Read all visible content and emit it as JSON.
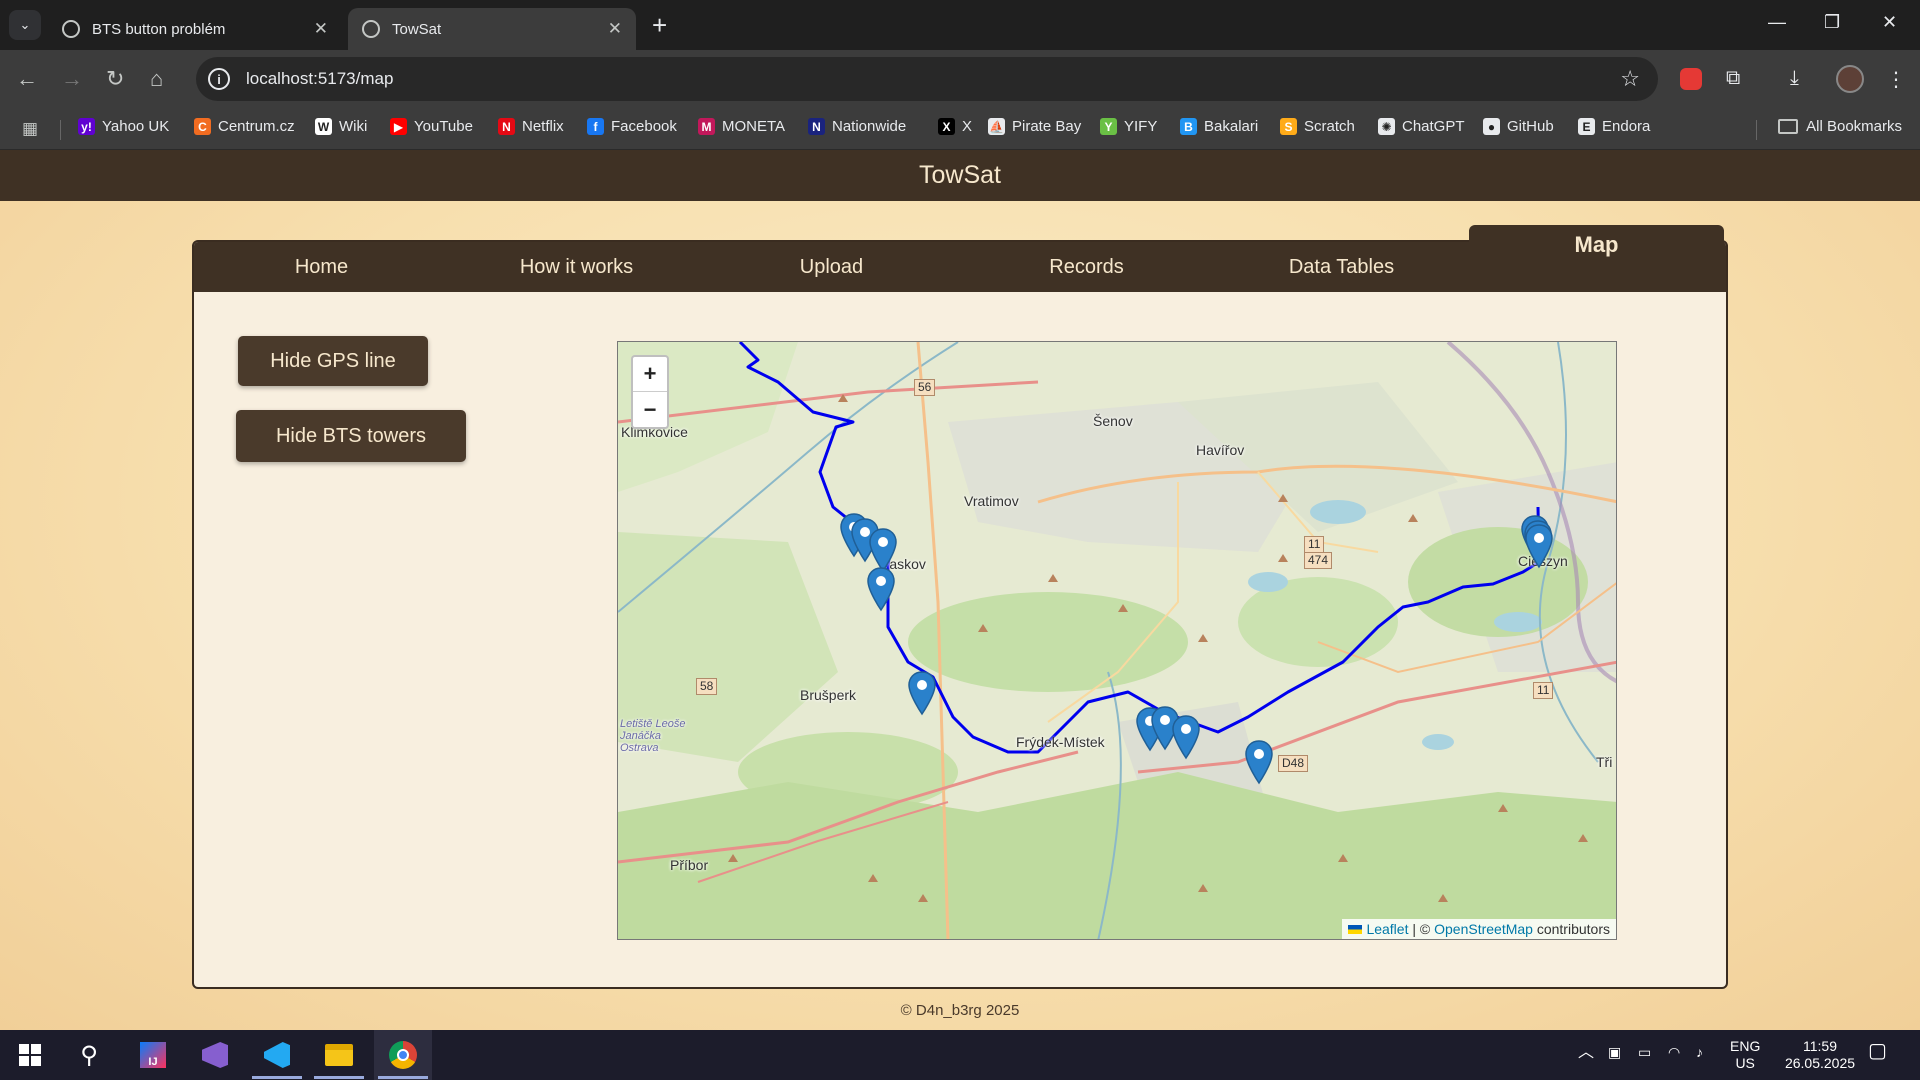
{
  "browser": {
    "tabs": [
      {
        "title": "BTS button problém",
        "active": false
      },
      {
        "title": "TowSat",
        "active": true
      }
    ],
    "url": "localhost:5173/map",
    "bookmarks": [
      {
        "label": "Yahoo UK",
        "icon": "yahoo-icon",
        "color": "#6001d2"
      },
      {
        "label": "Centrum.cz",
        "icon": "centrum-icon",
        "color": "#f26c21"
      },
      {
        "label": "Wiki",
        "icon": "wikipedia-icon",
        "color": "#ffffff"
      },
      {
        "label": "YouTube",
        "icon": "youtube-icon",
        "color": "#ff0000"
      },
      {
        "label": "Netflix",
        "icon": "netflix-icon",
        "color": "#e50914"
      },
      {
        "label": "Facebook",
        "icon": "facebook-icon",
        "color": "#1877f2"
      },
      {
        "label": "MONETA",
        "icon": "moneta-icon",
        "color": "#c2185b"
      },
      {
        "label": "Nationwide",
        "icon": "nationwide-icon",
        "color": "#1a237e"
      },
      {
        "label": "X",
        "icon": "x-icon",
        "color": "#000000"
      },
      {
        "label": "Pirate Bay",
        "icon": "piratebay-icon",
        "color": "#e8eaed"
      },
      {
        "label": "YIFY",
        "icon": "yify-icon",
        "color": "#6ac045"
      },
      {
        "label": "Bakalari",
        "icon": "bakalari-icon",
        "color": "#2196f3"
      },
      {
        "label": "Scratch",
        "icon": "scratch-icon",
        "color": "#ffab19"
      },
      {
        "label": "ChatGPT",
        "icon": "chatgpt-icon",
        "color": "#e8eaed"
      },
      {
        "label": "GitHub",
        "icon": "github-icon",
        "color": "#e8eaed"
      },
      {
        "label": "Endora",
        "icon": "endora-icon",
        "color": "#e8eaed"
      }
    ],
    "all_bookmarks": "All Bookmarks"
  },
  "app": {
    "title": "TowSat",
    "nav": [
      {
        "label": "Home",
        "active": false
      },
      {
        "label": "How it works",
        "active": false
      },
      {
        "label": "Upload",
        "active": false
      },
      {
        "label": "Records",
        "active": false
      },
      {
        "label": "Data Tables",
        "active": false
      },
      {
        "label": "Map",
        "active": true
      }
    ],
    "buttons": {
      "gps": "Hide GPS line",
      "bts": "Hide BTS towers"
    },
    "footer": "© D4n_b3rg 2025"
  },
  "map": {
    "zoom_in": "+",
    "zoom_out": "−",
    "attribution": {
      "leaflet": "Leaflet",
      "sep": " | © ",
      "osm": "OpenStreetMap",
      "suffix": " contributors"
    },
    "places": [
      "Klimkovice",
      "Šenov",
      "Havířov",
      "Vratimov",
      "Paskov",
      "Brušperk",
      "Frýdek-Místek",
      "Příbor",
      "Cieszyn",
      "Letiště Leoše Janáčka Ostrava",
      "Tři"
    ],
    "road_numbers": [
      "56",
      "58",
      "11",
      "474",
      "11",
      "D48"
    ],
    "route_color": "#0000ee",
    "marker_color": "#2a81cb",
    "marker_count": 12
  },
  "taskbar": {
    "lang": "ENG",
    "region": "US",
    "time": "11:59",
    "date": "26.05.2025"
  }
}
